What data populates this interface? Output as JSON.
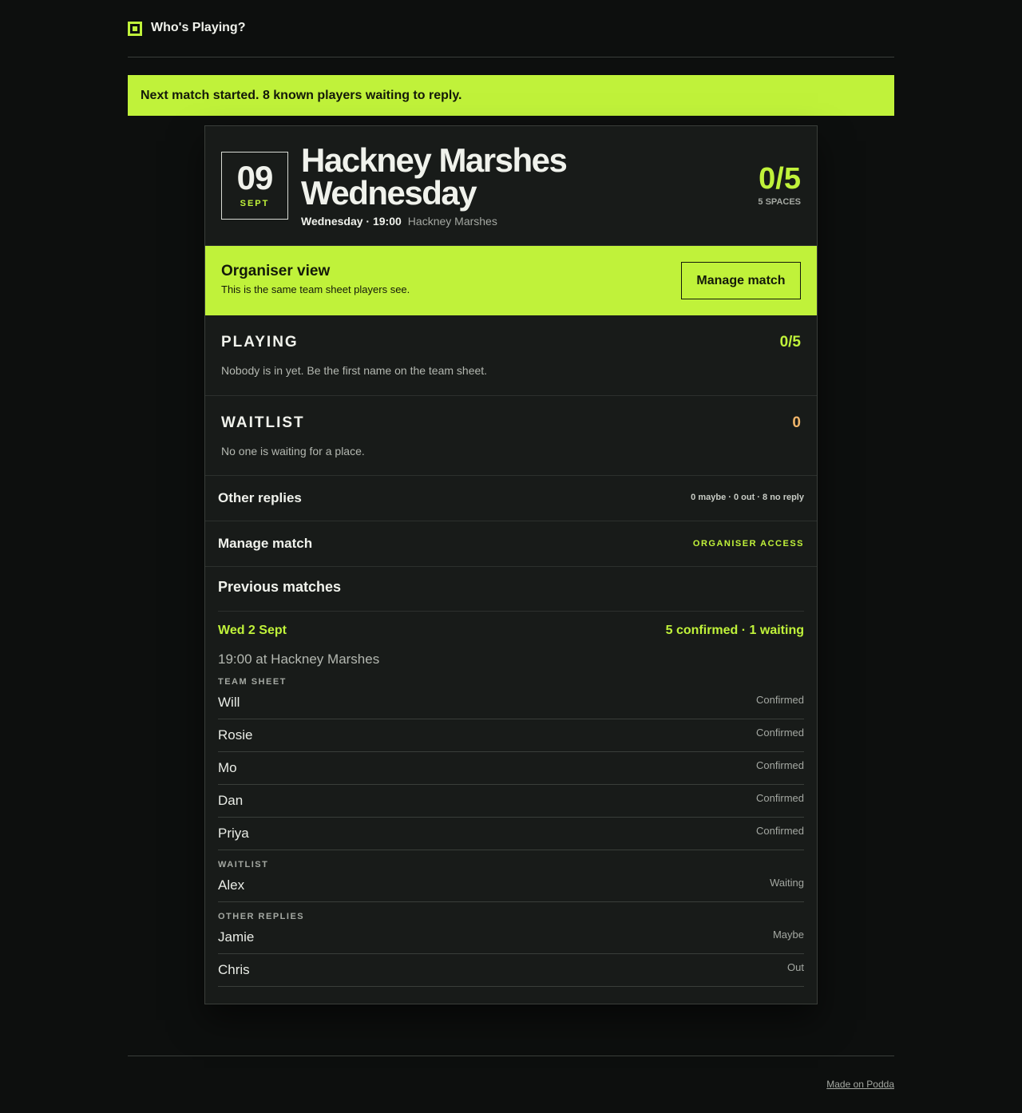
{
  "app": {
    "brand": "Who's Playing?",
    "logo_icon": "square-logo-icon",
    "accent": "#c0f23a"
  },
  "banner": {
    "text": "Next match started. 8 known players waiting to reply."
  },
  "match": {
    "day": "09",
    "month": "SEPT",
    "title": "Hackney Marshes Wednesday",
    "when": "Wednesday · 19:00",
    "where": "Hackney Marshes",
    "count": "0/5",
    "spaces": "5 SPACES"
  },
  "organiser": {
    "title": "Organiser view",
    "subtitle": "This is the same team sheet players see.",
    "manage_label": "Manage match"
  },
  "playing": {
    "heading": "PLAYING",
    "count": "0/5",
    "message": "Nobody is in yet. Be the first name on the team sheet."
  },
  "waitlist": {
    "heading": "WAITLIST",
    "count": "0",
    "message": "No one is waiting for a place."
  },
  "other_replies": {
    "label": "Other replies",
    "summary": "0 maybe · 0 out · 8 no reply"
  },
  "manage": {
    "label": "Manage match",
    "access": "ORGANISER ACCESS"
  },
  "previous": {
    "heading": "Previous matches",
    "match": {
      "date": "Wed 2 Sept",
      "summary": "5 confirmed · 1 waiting",
      "time_place": "19:00 at Hackney Marshes",
      "team_sheet_label": "TEAM SHEET",
      "team": [
        {
          "name": "Will",
          "status": "Confirmed"
        },
        {
          "name": "Rosie",
          "status": "Confirmed"
        },
        {
          "name": "Mo",
          "status": "Confirmed"
        },
        {
          "name": "Dan",
          "status": "Confirmed"
        },
        {
          "name": "Priya",
          "status": "Confirmed"
        }
      ],
      "waitlist_label": "WAITLIST",
      "waitlist": [
        {
          "name": "Alex",
          "status": "Waiting"
        }
      ],
      "other_label": "OTHER REPLIES",
      "other": [
        {
          "name": "Jamie",
          "status": "Maybe"
        },
        {
          "name": "Chris",
          "status": "Out"
        }
      ]
    }
  },
  "footer": {
    "link": "Made on Podda"
  }
}
